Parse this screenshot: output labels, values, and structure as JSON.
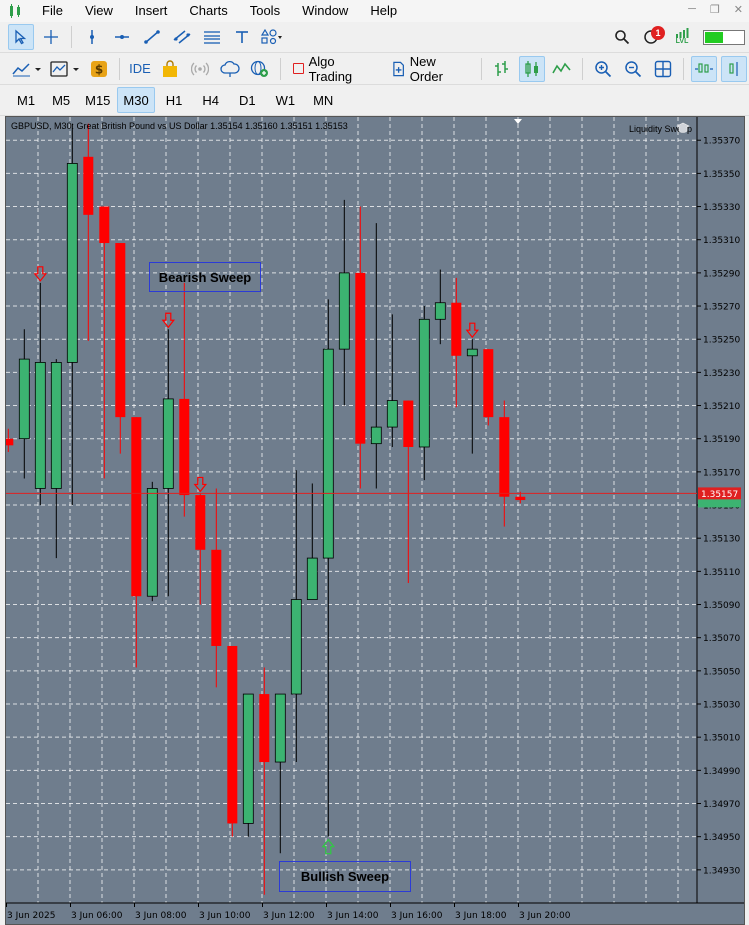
{
  "menu": {
    "items": [
      "File",
      "View",
      "Insert",
      "Charts",
      "Tools",
      "Window",
      "Help"
    ]
  },
  "toolbar": {
    "ide_label": "IDE",
    "algo_trading_label": "Algo Trading",
    "new_order_label": "New Order",
    "notification_count": "1",
    "signal_label": "LVL"
  },
  "timeframes": [
    "M1",
    "M5",
    "M15",
    "M30",
    "H1",
    "H4",
    "D1",
    "W1",
    "MN"
  ],
  "active_timeframe": "M30",
  "chart": {
    "title": "GBPUSD, M30:  Great British Pound vs US Dollar  1.35154 1.35160 1.35151 1.35153",
    "indicator_name": "Liquidity Sweep",
    "current_price_label": "1.35157",
    "current_price": 1.35157,
    "colors": {
      "background": "#6f7d8d",
      "bull": "#3cb371",
      "bear": "#ff0000",
      "grid": "#ffffff",
      "annotation_border": "#2b3bd6"
    }
  },
  "annotations": {
    "bearish": "Bearish Sweep",
    "bullish": "Bullish Sweep"
  },
  "chart_data": {
    "type": "candlestick",
    "symbol": "GBPUSD",
    "timeframe": "M30",
    "ylim": [
      1.3491,
      1.35384
    ],
    "y_ticks": [
      "1.35370",
      "1.35350",
      "1.35330",
      "1.35310",
      "1.35290",
      "1.35270",
      "1.35250",
      "1.35230",
      "1.35210",
      "1.35190",
      "1.35170",
      "1.35150",
      "1.35130",
      "1.35110",
      "1.35090",
      "1.35070",
      "1.35050",
      "1.35030",
      "1.35010",
      "1.34990",
      "1.34970",
      "1.34950",
      "1.34930"
    ],
    "x_ticks": [
      "3 Jun 2025",
      "3 Jun 06:00",
      "3 Jun 08:00",
      "3 Jun 10:00",
      "3 Jun 12:00",
      "3 Jun 14:00",
      "3 Jun 16:00",
      "3 Jun 18:00",
      "3 Jun 20:00"
    ],
    "candles": [
      {
        "o": 1.3519,
        "h": 1.35196,
        "l": 1.35182,
        "c": 1.35186
      },
      {
        "o": 1.3519,
        "h": 1.35256,
        "l": 1.35166,
        "c": 1.35238
      },
      {
        "o": 1.3516,
        "h": 1.35284,
        "l": 1.3515,
        "c": 1.35236
      },
      {
        "o": 1.3516,
        "h": 1.35238,
        "l": 1.35118,
        "c": 1.35236
      },
      {
        "o": 1.35236,
        "h": 1.3538,
        "l": 1.3515,
        "c": 1.35356
      },
      {
        "o": 1.3536,
        "h": 1.3538,
        "l": 1.35249,
        "c": 1.35325
      },
      {
        "o": 1.3533,
        "h": 1.3533,
        "l": 1.35166,
        "c": 1.35308
      },
      {
        "o": 1.35308,
        "h": 1.35308,
        "l": 1.35181,
        "c": 1.35203
      },
      {
        "o": 1.35203,
        "h": 1.35203,
        "l": 1.35052,
        "c": 1.35095
      },
      {
        "o": 1.35095,
        "h": 1.35164,
        "l": 1.35092,
        "c": 1.3516
      },
      {
        "o": 1.3516,
        "h": 1.35256,
        "l": 1.35095,
        "c": 1.35214
      },
      {
        "o": 1.35214,
        "h": 1.35284,
        "l": 1.35143,
        "c": 1.35156
      },
      {
        "o": 1.35156,
        "h": 1.35157,
        "l": 1.3509,
        "c": 1.35123
      },
      {
        "o": 1.35123,
        "h": 1.3516,
        "l": 1.3504,
        "c": 1.35065
      },
      {
        "o": 1.35065,
        "h": 1.35065,
        "l": 1.3495,
        "c": 1.34958
      },
      {
        "o": 1.34958,
        "h": 1.35032,
        "l": 1.3495,
        "c": 1.35036
      },
      {
        "o": 1.35036,
        "h": 1.35052,
        "l": 1.34915,
        "c": 1.34995
      },
      {
        "o": 1.34995,
        "h": 1.35036,
        "l": 1.3494,
        "c": 1.35036
      },
      {
        "o": 1.35036,
        "h": 1.35171,
        "l": 1.34995,
        "c": 1.35093
      },
      {
        "o": 1.35093,
        "h": 1.35163,
        "l": 1.35093,
        "c": 1.35118
      },
      {
        "o": 1.35118,
        "h": 1.35274,
        "l": 1.3495,
        "c": 1.35244
      },
      {
        "o": 1.35244,
        "h": 1.35334,
        "l": 1.3521,
        "c": 1.3529
      },
      {
        "o": 1.3529,
        "h": 1.3533,
        "l": 1.3516,
        "c": 1.35187
      },
      {
        "o": 1.35187,
        "h": 1.3532,
        "l": 1.3516,
        "c": 1.35197
      },
      {
        "o": 1.35197,
        "h": 1.35265,
        "l": 1.35185,
        "c": 1.35213
      },
      {
        "o": 1.35213,
        "h": 1.35213,
        "l": 1.35103,
        "c": 1.35185
      },
      {
        "o": 1.35185,
        "h": 1.3527,
        "l": 1.35165,
        "c": 1.35262
      },
      {
        "o": 1.35262,
        "h": 1.35292,
        "l": 1.35247,
        "c": 1.35272
      },
      {
        "o": 1.35272,
        "h": 1.35287,
        "l": 1.35209,
        "c": 1.3524
      },
      {
        "o": 1.3524,
        "h": 1.3525,
        "l": 1.35181,
        "c": 1.35244
      },
      {
        "o": 1.35244,
        "h": 1.35244,
        "l": 1.35198,
        "c": 1.35203
      },
      {
        "o": 1.35203,
        "h": 1.35213,
        "l": 1.35137,
        "c": 1.35155
      },
      {
        "o": 1.35155,
        "h": 1.35158,
        "l": 1.35151,
        "c": 1.35153
      }
    ],
    "bearish_sweep_candles": [
      2,
      10,
      12,
      29
    ],
    "bullish_sweep_candles": [
      20
    ]
  }
}
